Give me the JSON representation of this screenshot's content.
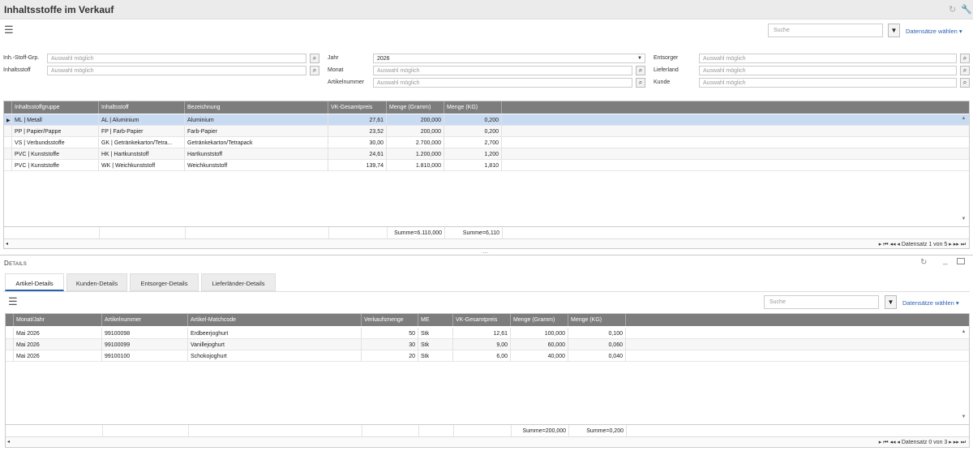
{
  "title": "Inhaltsstoffe im Verkauf",
  "toolbar": {
    "search_placeholder": "Suche",
    "dataset_label": "Datensätze wählen"
  },
  "filters": {
    "inh_stoff_grp": {
      "label": "Inh.-Stoff-Grp.",
      "placeholder": "Auswahl möglich"
    },
    "inhaltsstoff": {
      "label": "Inhaltsstoff",
      "placeholder": "Auswahl möglich"
    },
    "jahr": {
      "label": "Jahr",
      "value": "2026"
    },
    "monat": {
      "label": "Monat",
      "placeholder": "Auswahl möglich"
    },
    "artikelnummer": {
      "label": "Artikelnummer",
      "placeholder": "Auswahl möglich"
    },
    "entsorger": {
      "label": "Entsorger",
      "placeholder": "Auswahl möglich"
    },
    "lieferland": {
      "label": "Lieferland",
      "placeholder": "Auswahl möglich"
    },
    "kunde": {
      "label": "Kunde",
      "placeholder": "Auswahl möglich"
    }
  },
  "main_grid": {
    "columns": [
      "Inhaltsstoffgruppe",
      "Inhaltsstoff",
      "Bezeichnung",
      "VK-Gesamtpreis",
      "Menge (Gramm)",
      "Menge (KG)"
    ],
    "rows": [
      [
        "ML | Metall",
        "AL | Aluminium",
        "Aluminium",
        "27,61",
        "200,000",
        "0,200"
      ],
      [
        "PP | Papier/Pappe",
        "FP | Farb-Papier",
        "Farb-Papier",
        "23,52",
        "200,000",
        "0,200"
      ],
      [
        "VS | Verbundsstoffe",
        "GK | Getränkekarton/Tetra...",
        "Getränkekarton/Tetrapack",
        "30,00",
        "2.700,000",
        "2,700"
      ],
      [
        "PVC | Kunststoffe",
        "HK | Hartkunststoff",
        "Hartkunststoff",
        "24,61",
        "1.200,000",
        "1,200"
      ],
      [
        "PVC | Kunststoffe",
        "WK | Weichkunststoff",
        "Weichkunststoff",
        "139,74",
        "1.810,000",
        "1,810"
      ]
    ],
    "sum_gramm": "Summe=6.110,000",
    "sum_kg": "Summe=6,110",
    "pager": "Datensatz 1 von 5"
  },
  "details": {
    "title": "Details",
    "tabs": [
      "Artikel-Details",
      "Kunden-Details",
      "Entsorger-Details",
      "Lieferländer-Details"
    ],
    "search_placeholder": "Suche",
    "dataset_label": "Datensätze wählen",
    "columns": [
      "Monat/Jahr",
      "Artikelnummer",
      "Artikel-Matchcode",
      "Verkaufsmenge",
      "ME",
      "VK-Gesamtpreis",
      "Menge (Gramm)",
      "Menge (KG)"
    ],
    "rows": [
      [
        "Mai 2026",
        "99100098",
        "Erdbeerjoghurt",
        "50",
        "Stk",
        "12,61",
        "100,000",
        "0,100"
      ],
      [
        "Mai 2026",
        "99100099",
        "Vanillejoghurt",
        "30",
        "Stk",
        "9,00",
        "60,000",
        "0,060"
      ],
      [
        "Mai 2026",
        "99100100",
        "Schokojoghurt",
        "20",
        "Stk",
        "6,00",
        "40,000",
        "0,040"
      ]
    ],
    "sum_gramm": "Summe=200,000",
    "sum_kg": "Summe=0,200",
    "pager": "Datensatz 0 von 3"
  }
}
